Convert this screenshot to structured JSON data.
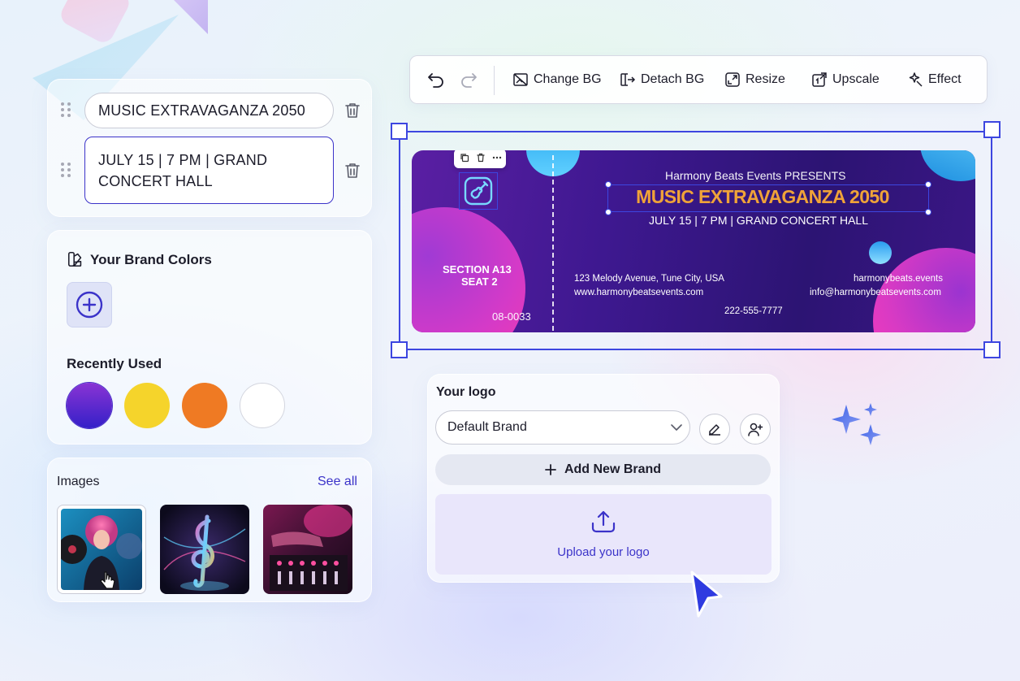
{
  "text_fields": {
    "field1_value": "MUSIC EXTRAVAGANZA 2050",
    "field2_value": "JULY 15 | 7 PM | GRAND CONCERT HALL"
  },
  "brand_colors": {
    "title": "Your Brand Colors",
    "recently_used_label": "Recently Used",
    "recent_colors": [
      "#5b2ec9",
      "#f5d42b",
      "#ef7a23",
      "#ffffff"
    ]
  },
  "images": {
    "title": "Images",
    "see_all": "See all"
  },
  "toolbar": {
    "change_bg": "Change BG",
    "detach_bg": "Detach BG",
    "resize": "Resize",
    "upscale": "Upscale",
    "effect": "Effect"
  },
  "ticket": {
    "presents": "Harmony Beats Events PRESENTS",
    "title": "MUSIC EXTRAVAGANZA 2050",
    "date_line": "JULY 15 | 7 PM | GRAND CONCERT HALL",
    "section": "SECTION A13",
    "seat": "SEAT 2",
    "ticket_number": "08-0033",
    "address": "123 Melody Avenue, Tune City, USA",
    "website": "www.harmonybeatsevents.com",
    "social": "harmonybeats.events",
    "email": "info@harmonybeatsevents.com",
    "phone": "222-555-7777"
  },
  "logo_panel": {
    "title": "Your logo",
    "selected_brand": "Default Brand",
    "add_brand": "Add New Brand",
    "upload": "Upload your logo"
  },
  "colors": {
    "accent": "#3b33c9",
    "selection": "#3d46e0",
    "ticket_gold": "#f0a338"
  }
}
